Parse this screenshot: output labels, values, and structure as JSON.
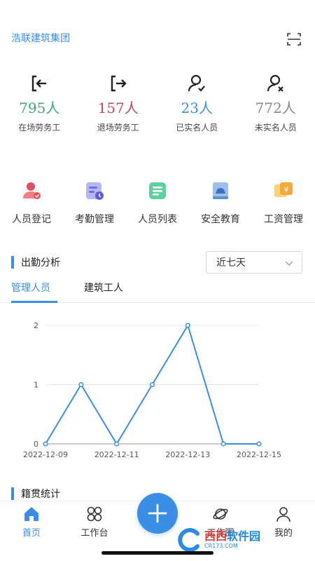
{
  "header": {
    "company": "浩联建筑集团",
    "scan_icon": "scan-icon"
  },
  "stats": [
    {
      "value": "795人",
      "label": "在场劳务工",
      "color": "#3aa876",
      "icon": "enter-site-icon"
    },
    {
      "value": "157人",
      "label": "退场劳务工",
      "color": "#c44a5a",
      "icon": "exit-site-icon"
    },
    {
      "value": "23人",
      "label": "已实名人员",
      "color": "#3a8ee6",
      "icon": "verified-user-icon"
    },
    {
      "value": "772人",
      "label": "未实名人员",
      "color": "#888888",
      "icon": "unverified-user-icon"
    }
  ],
  "menu": [
    {
      "label": "人员登记",
      "icon": "person-register-icon"
    },
    {
      "label": "考勤管理",
      "icon": "attendance-icon"
    },
    {
      "label": "人员列表",
      "icon": "person-list-icon"
    },
    {
      "label": "安全教育",
      "icon": "safety-education-icon"
    },
    {
      "label": "工资管理",
      "icon": "salary-icon"
    }
  ],
  "attendance": {
    "title": "出勤分析",
    "range_selected": "近七天",
    "tabs": [
      "管理人员",
      "建筑工人"
    ]
  },
  "chart_data": {
    "type": "line",
    "x": [
      "2022-12-09",
      "2022-12-10",
      "2022-12-11",
      "2022-12-12",
      "2022-12-13",
      "2022-12-14",
      "2022-12-15"
    ],
    "values": [
      0,
      1,
      0,
      1,
      2,
      0,
      0
    ],
    "x_tick_labels": [
      "2022-12-09",
      "2022-12-11",
      "2022-12-13",
      "2022-12-15"
    ],
    "y_ticks": [
      0,
      1,
      2
    ],
    "ylim": [
      0,
      2
    ],
    "grid": true,
    "color": "#3a8ee6"
  },
  "origin": {
    "title": "籍贯统计"
  },
  "nav": {
    "items": [
      {
        "label": "首页",
        "icon": "home-icon",
        "active": true
      },
      {
        "label": "工作台",
        "icon": "workbench-icon",
        "active": false
      },
      {
        "label": "工作圈",
        "icon": "planet-icon",
        "active": false
      },
      {
        "label": "我的",
        "icon": "profile-icon",
        "active": false
      }
    ],
    "fab_icon": "add-icon"
  },
  "watermark": "西西软件园 CR173.COM"
}
